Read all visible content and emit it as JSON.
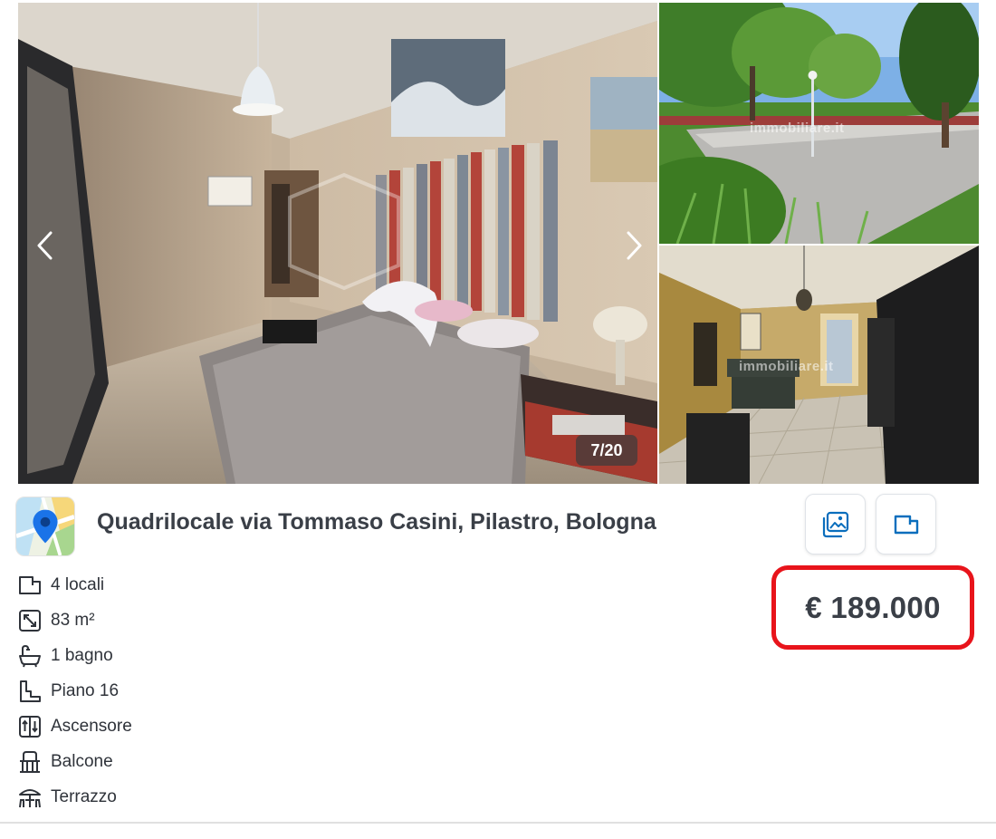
{
  "gallery": {
    "counter": "7/20",
    "watermark": "immobiliare.it",
    "prev_icon": "chevron-left-icon",
    "next_icon": "chevron-right-icon"
  },
  "listing": {
    "title": "Quadrilocale via Tommaso Casini, Pilastro, Bologna",
    "price": "€ 189.000",
    "logo_icon": "map-pin-icon"
  },
  "actions": {
    "photos_icon": "photos-icon",
    "floorplan_icon": "floorplan-icon"
  },
  "features": [
    {
      "icon": "rooms-icon",
      "label": "4 locali"
    },
    {
      "icon": "surface-icon",
      "label": "83 m²"
    },
    {
      "icon": "bathtub-icon",
      "label": "1 bagno"
    },
    {
      "icon": "floor-icon",
      "label": "Piano 16"
    },
    {
      "icon": "elevator-icon",
      "label": "Ascensore"
    },
    {
      "icon": "balcony-icon",
      "label": "Balcone"
    },
    {
      "icon": "terrace-icon",
      "label": "Terrazzo"
    }
  ],
  "colors": {
    "highlight": "#e8141b",
    "accent": "#0a6ebd"
  }
}
